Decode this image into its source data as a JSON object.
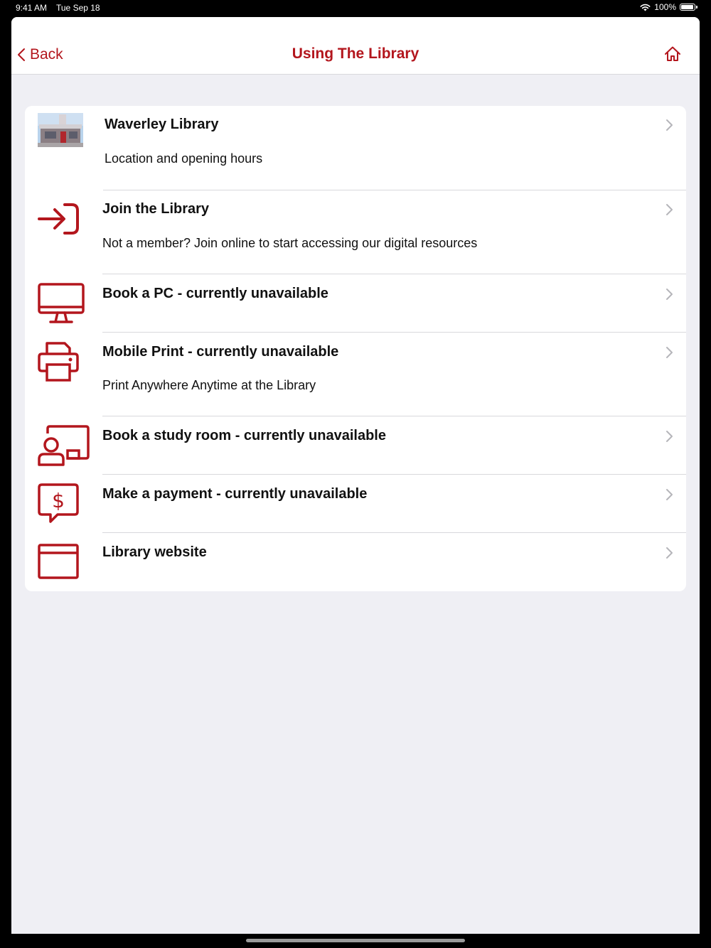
{
  "status_bar": {
    "time": "9:41 AM",
    "date": "Tue Sep 18",
    "battery": "100%",
    "battery_level": 1.0
  },
  "nav": {
    "back_label": "Back",
    "title": "Using The Library",
    "home_icon": "home-icon"
  },
  "colors": {
    "accent": "#b3161d",
    "background": "#efeff4",
    "divider": "#d8d8dc"
  },
  "items": [
    {
      "title": "Waverley Library",
      "subtitle": "Location and opening hours",
      "icon": "library-photo"
    },
    {
      "title": "Join the Library",
      "subtitle": "Not a member? Join online to start accessing our digital resources",
      "icon": "join-arrow-icon"
    },
    {
      "title": "Book a PC - currently unavailable",
      "subtitle": "",
      "icon": "monitor-icon"
    },
    {
      "title": "Mobile Print - currently unavailable",
      "subtitle": "Print Anywhere Anytime at the Library",
      "icon": "printer-icon"
    },
    {
      "title": "Book a study room - currently unavailable",
      "subtitle": "",
      "icon": "study-room-icon"
    },
    {
      "title": "Make a payment - currently unavailable",
      "subtitle": "",
      "icon": "payment-icon"
    },
    {
      "title": "Library website",
      "subtitle": "",
      "icon": "browser-window-icon"
    }
  ]
}
